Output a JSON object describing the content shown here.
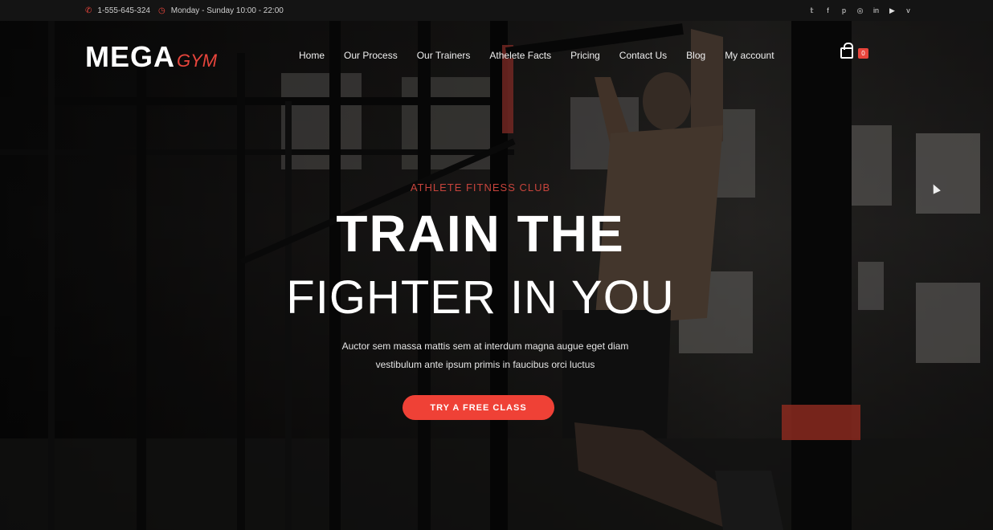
{
  "topbar": {
    "phone": "1-555-645-324",
    "hours": "Monday - Sunday 10:00 - 22:00",
    "socials": [
      "twitter-icon",
      "facebook-icon",
      "pinterest-icon",
      "instagram-icon",
      "linkedin-icon",
      "youtube-icon",
      "vimeo-icon"
    ]
  },
  "brand": {
    "primary": "MEGA",
    "accent": "GYM",
    "accent_color": "#e8453c"
  },
  "nav": {
    "items": [
      "Home",
      "Our Process",
      "Our Trainers",
      "Athelete Facts",
      "Pricing",
      "Contact Us",
      "Blog",
      "My account"
    ],
    "cart_count": "0"
  },
  "hero": {
    "eyebrow": "ATHLETE FITNESS CLUB",
    "title_line1": "TRAIN THE",
    "title_line2": "FIGHTER IN YOU",
    "description_line1": "Auctor sem massa mattis sem at interdum magna augue eget diam",
    "description_line2": "vestibulum ante ipsum primis in faucibus orci luctus",
    "cta_label": "TRY A FREE CLASS",
    "cta_color": "#ef4136"
  }
}
